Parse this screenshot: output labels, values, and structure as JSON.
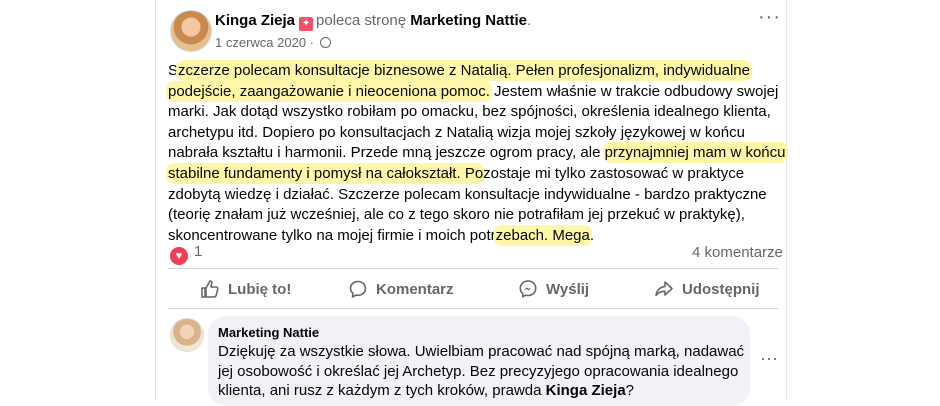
{
  "post": {
    "author": "Kinga Zieja",
    "verb": "poleca stronę",
    "page": "Marketing Nattie",
    "date": "1 czerwca 2020",
    "body": {
      "l1a": "S",
      "l1b": "zczerze polecam konsultacje biznesowe z Natalią. Pełen profesjonalizm, indywidualne",
      "l2a": "podejście, zaangażowanie i nieoceniona pomoc.",
      "l2b": " Jestem właśnie w trakcie odbudowy swojej",
      "l3": "marki. Jak dotąd wszystko robiłam po omacku, bez spójności, określenia idealnego klienta,",
      "l4": "archetypu itd. Dopiero po konsultacjach z Natalią wizja mojej szkoły językowej w końcu",
      "l5": "nabrała kształtu i harmonii. Przede mną jeszcze ogrom pracy, ale ",
      "l5h": "przynajmniej mam w końcu",
      "l6a": "stabilne fundamenty i pomysł na całokształt. Po",
      "l6b": "zostaje mi tylko zastosować w praktyce",
      "l7": "zdobytą wiedzę i działać. Szczerze polecam konsultacje indywidualne - bardzo praktyczne",
      "l8": "(teorię znałam już wcześniej, ale co z tego skoro nie potrafiłam jej przekuć w praktykę),",
      "l9a": "skoncentrowane tylko na mojej firmie i moich potr",
      "l9h": "zebach. Mega",
      "l9b": "."
    },
    "reaction_count": "1",
    "comments_count": "4 komentarze"
  },
  "actions": {
    "like": "Lubię to!",
    "comment": "Komentarz",
    "send": "Wyślij",
    "share": "Udostępnij"
  },
  "comment": {
    "author": "Marketing Nattie",
    "l1": "Dziękuję za wszystkie słowa. Uwielbiam pracować nad spójną marką, nadawać",
    "l2": "jej osobowość i określać jej Archetyp. Bez precyzyjego opracowania idealnego",
    "l3a": "klienta, ani rusz z każdym z tych kroków, prawda ",
    "l3b": "Kinga Zieja",
    "l3c": "?"
  },
  "icons": {
    "badge": "recommend-badge-icon",
    "globe": "globe-icon",
    "heart": "heart-reaction-icon",
    "like": "thumbs-up-icon",
    "comment": "comment-bubble-icon",
    "send": "messenger-icon",
    "share": "share-arrow-icon"
  },
  "colors": {
    "highlight": "#fff7a8",
    "heart": "#f33e58",
    "badge": "#f25268",
    "muted": "#65676b"
  }
}
